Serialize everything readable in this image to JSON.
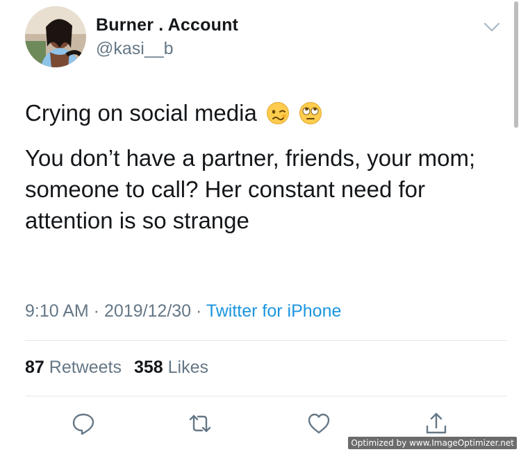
{
  "tweet": {
    "author": {
      "display_name": "Burner . Account",
      "handle": "@kasi__b"
    },
    "text": {
      "line1": "Crying on social media",
      "line1_emojis": [
        "woozy-face-emoji",
        "face-with-rolling-eyes-emoji"
      ],
      "line2": "You don’t have a partner, friends, your mom; someone to call? Her constant need for attention is so strange"
    },
    "meta": {
      "time": "9:10 AM",
      "separator": " · ",
      "date": "2019/12/30",
      "source": "Twitter for iPhone"
    },
    "stats": {
      "retweets_count": "87",
      "retweets_label": "Retweets",
      "likes_count": "358",
      "likes_label": "Likes"
    },
    "actions": [
      "reply-icon",
      "retweet-icon",
      "like-icon",
      "share-icon"
    ]
  },
  "watermark": "Optimized by www.ImageOptimizer.net",
  "colors": {
    "text_primary": "#14171a",
    "text_secondary": "#657786",
    "link": "#1b95e0",
    "divider": "#e1e8ed"
  }
}
